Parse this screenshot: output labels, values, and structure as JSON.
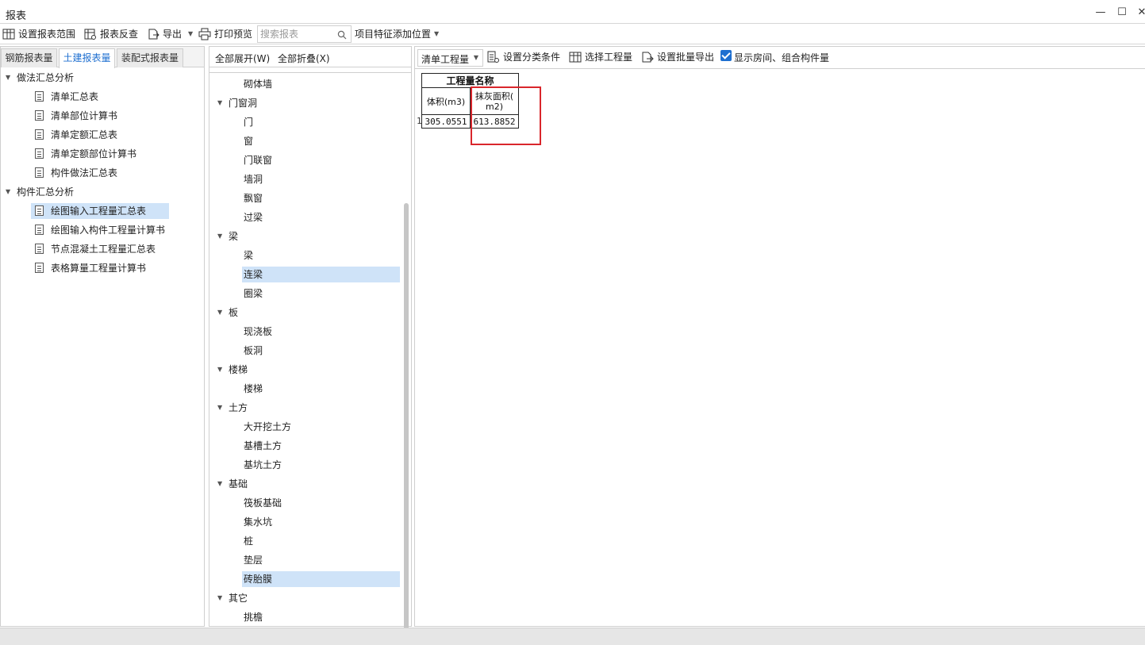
{
  "window": {
    "title": "报表",
    "minimize_glyph": "—",
    "maximize_glyph": "☐",
    "close_glyph": "✕"
  },
  "toolbar": {
    "set_range": "设置报表范围",
    "reverse_check": "报表反查",
    "export": "导出",
    "print_preview": "打印预览",
    "search_placeholder": "搜索报表",
    "feature_position": "项目特征添加位置"
  },
  "left": {
    "tabs": [
      "钢筋报表量",
      "土建报表量",
      "装配式报表量"
    ],
    "active_tab": "土建报表量",
    "groups": [
      {
        "label": "做法汇总分析",
        "items": [
          "清单汇总表",
          "清单部位计算书",
          "清单定额汇总表",
          "清单定额部位计算书",
          "构件做法汇总表"
        ]
      },
      {
        "label": "构件汇总分析",
        "items": [
          "绘图输入工程量汇总表",
          "绘图输入构件工程量计算书",
          "节点混凝土工程量汇总表",
          "表格算量工程量计算书"
        ]
      }
    ],
    "selected_item": "绘图输入工程量汇总表"
  },
  "middle": {
    "expand_all": "全部展开(W)",
    "collapse_all": "全部折叠(X)",
    "tree": {
      "top_item": "砌体墙",
      "groups": [
        {
          "label": "门窗洞",
          "items": [
            "门",
            "窗",
            "门联窗",
            "墙洞",
            "飘窗",
            "过梁"
          ]
        },
        {
          "label": "梁",
          "items": [
            "梁",
            "连梁",
            "圈梁"
          ]
        },
        {
          "label": "板",
          "items": [
            "现浇板",
            "板洞"
          ]
        },
        {
          "label": "楼梯",
          "items": [
            "楼梯"
          ]
        },
        {
          "label": "土方",
          "items": [
            "大开挖土方",
            "基槽土方",
            "基坑土方"
          ]
        },
        {
          "label": "基础",
          "items": [
            "筏板基础",
            "集水坑",
            "桩",
            "垫层",
            "砖胎膜"
          ]
        },
        {
          "label": "其它",
          "items": [
            "挑檐"
          ]
        }
      ]
    },
    "selected_items": [
      "连梁",
      "砖胎膜"
    ]
  },
  "right": {
    "dropdown_value": "清单工程量",
    "set_category": "设置分类条件",
    "select_quantity": "选择工程量",
    "batch_export": "设置批量导出",
    "show_rooms": "显示房间、组合构件量",
    "show_rooms_checked": true,
    "table": {
      "header": "工程量名称",
      "columns": [
        "体积(m3)",
        "抹灰面积(\nm2)"
      ],
      "rows": [
        {
          "index": "1",
          "values": [
            "305.0551",
            "613.8852"
          ]
        }
      ]
    }
  },
  "colors": {
    "accent": "#1e6fd0",
    "selection": "#cfe3f8",
    "highlight_border": "#d9262c"
  }
}
